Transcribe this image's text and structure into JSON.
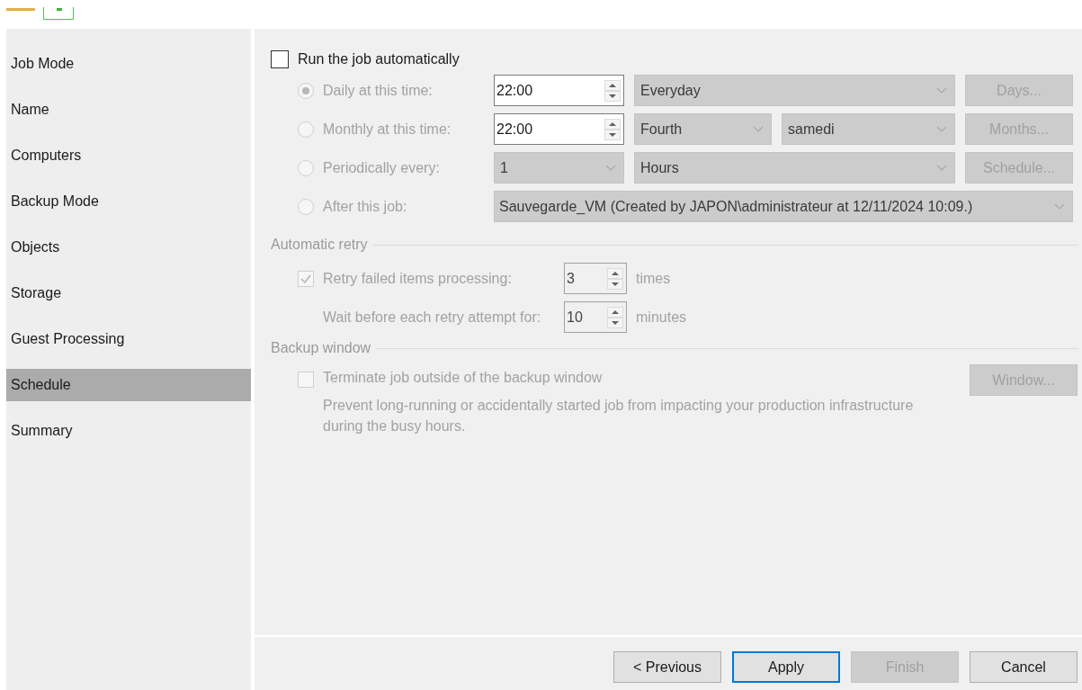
{
  "sidebar": {
    "items": [
      {
        "label": "Job Mode",
        "selected": false
      },
      {
        "label": "Name",
        "selected": false
      },
      {
        "label": "Computers",
        "selected": false
      },
      {
        "label": "Backup Mode",
        "selected": false
      },
      {
        "label": "Objects",
        "selected": false
      },
      {
        "label": "Storage",
        "selected": false
      },
      {
        "label": "Guest Processing",
        "selected": false
      },
      {
        "label": "Schedule",
        "selected": true
      },
      {
        "label": "Summary",
        "selected": false
      }
    ]
  },
  "run_automatically": {
    "label": "Run the job automatically",
    "checked": false
  },
  "schedule": {
    "disabled": true,
    "options": [
      {
        "kind": "time",
        "label": "Daily at this time:",
        "selected": true,
        "time": "22:00",
        "dropdowns": [
          "Everyday"
        ],
        "button": "Days..."
      },
      {
        "kind": "time",
        "label": "Monthly at this time:",
        "selected": false,
        "time": "22:00",
        "dropdowns": [
          "Fourth",
          "samedi"
        ],
        "button": "Months..."
      },
      {
        "kind": "periodic",
        "label": "Periodically every:",
        "selected": false,
        "dropdowns": [
          "1",
          "Hours"
        ],
        "button": "Schedule..."
      },
      {
        "kind": "job",
        "label": "After this job:",
        "selected": false,
        "dropdowns": [
          "Sauvegarde_VM (Created by JAPON\\administrateur at 12/11/2024 10:09.)"
        ]
      }
    ]
  },
  "automatic_retry": {
    "title": "Automatic retry",
    "disabled": true,
    "retry": {
      "label": "Retry failed items processing:",
      "checked": true,
      "value": "3",
      "unit": "times"
    },
    "wait": {
      "label": "Wait before each retry attempt for:",
      "value": "10",
      "unit": "minutes"
    }
  },
  "backup_window": {
    "title": "Backup window",
    "disabled": true,
    "terminate": {
      "label": "Terminate job outside of the backup window",
      "checked": false
    },
    "description": "Prevent long-running or accidentally started job from impacting your production infrastructure during the busy hours.",
    "button": "Window..."
  },
  "buttons": [
    {
      "label": "< Previous",
      "default": false,
      "disabled": false
    },
    {
      "label": "Apply",
      "default": true,
      "disabled": false
    },
    {
      "label": "Finish",
      "default": false,
      "disabled": true
    },
    {
      "label": "Cancel",
      "default": false,
      "disabled": false
    }
  ]
}
